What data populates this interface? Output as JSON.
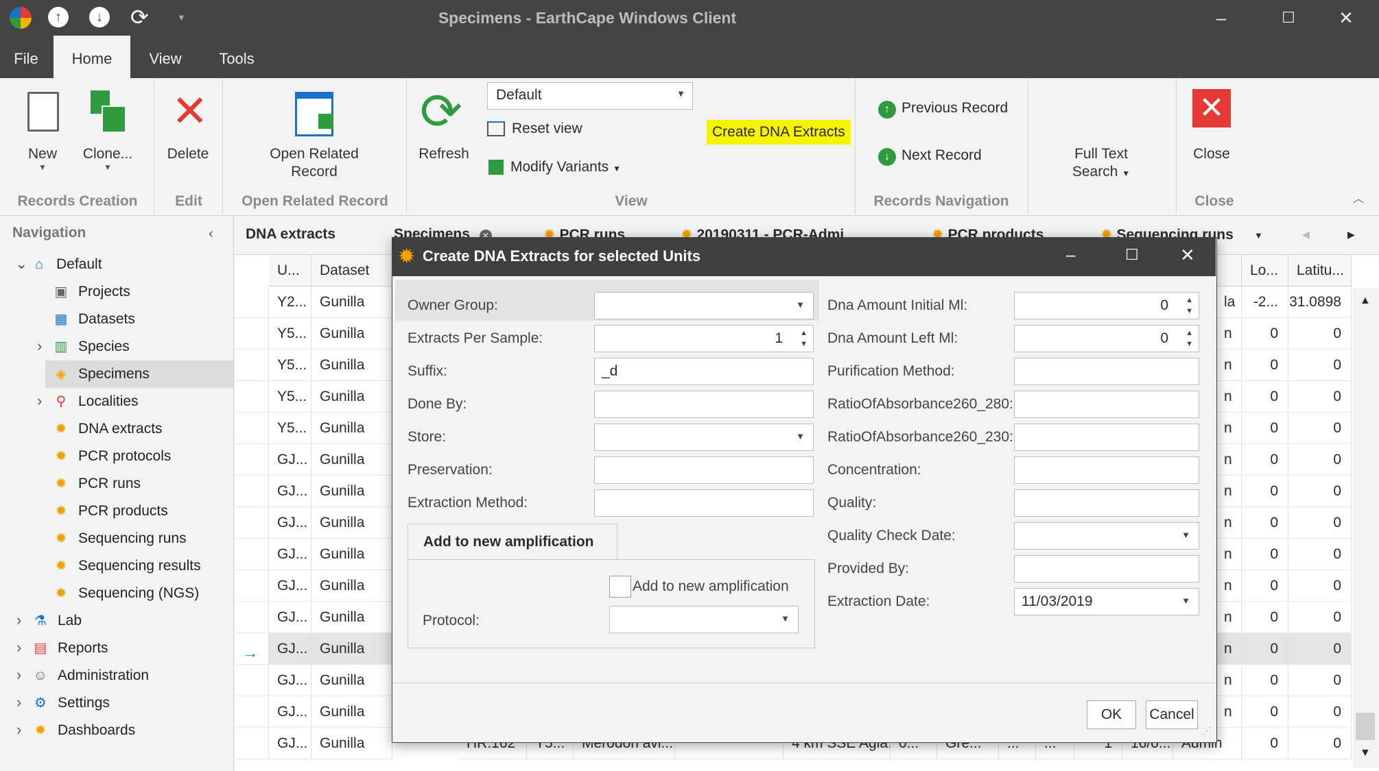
{
  "window": {
    "title": "Specimens - EarthCape Windows Client"
  },
  "menu": {
    "file": "File",
    "home": "Home",
    "view": "View",
    "tools": "Tools"
  },
  "ribbon": {
    "new": "New",
    "clone": "Clone...",
    "delete": "Delete",
    "open_related": "Open Related Record",
    "refresh": "Refresh",
    "view_combo": "Default",
    "reset_view": "Reset view",
    "modify_variants": "Modify Variants",
    "create_dna": "Create DNA Extracts",
    "prev_record": "Previous Record",
    "next_record": "Next Record",
    "full_text": "Full Text Search",
    "close": "Close",
    "groups": {
      "records_creation": "Records Creation",
      "edit": "Edit",
      "open_related": "Open Related Record",
      "view": "View",
      "records_nav": "Records Navigation",
      "close": "Close"
    },
    "colors": {
      "highlight": "#f4f400",
      "delete": "#e53935",
      "close_bg": "#e53935",
      "green": "#2e9b3e",
      "blue": "#1a73c8"
    }
  },
  "navigation": {
    "header": "Navigation",
    "items": [
      "Default",
      "Projects",
      "Datasets",
      "Species",
      "Specimens",
      "Localities",
      "DNA extracts",
      "PCR protocols",
      "PCR runs",
      "PCR products",
      "Sequencing runs",
      "Sequencing results",
      "Sequencing (NGS)",
      "Lab",
      "Reports",
      "Administration",
      "Settings",
      "Dashboards"
    ]
  },
  "grid": {
    "caption": "DNA extracts",
    "tabs": [
      "Specimens",
      "PCR runs",
      "20190311 - PCR-Admi",
      "PCR products",
      "Sequencing runs"
    ],
    "headers": [
      "U...",
      "Dataset",
      "Lo...",
      "Latitu..."
    ],
    "rows": [
      {
        "u": "Y2...",
        "ds": "Gunilla",
        "x": "la",
        "lo": "-2...",
        "lat": "31.0898"
      },
      {
        "u": "Y5...",
        "ds": "Gunilla",
        "x": "n",
        "lo": "0",
        "lat": "0"
      },
      {
        "u": "Y5...",
        "ds": "Gunilla",
        "x": "n",
        "lo": "0",
        "lat": "0"
      },
      {
        "u": "Y5...",
        "ds": "Gunilla",
        "x": "n",
        "lo": "0",
        "lat": "0"
      },
      {
        "u": "Y5...",
        "ds": "Gunilla",
        "x": "n",
        "lo": "0",
        "lat": "0"
      },
      {
        "u": "GJ...",
        "ds": "Gunilla",
        "x": "n",
        "lo": "0",
        "lat": "0"
      },
      {
        "u": "GJ...",
        "ds": "Gunilla",
        "x": "n",
        "lo": "0",
        "lat": "0"
      },
      {
        "u": "GJ...",
        "ds": "Gunilla",
        "x": "n",
        "lo": "0",
        "lat": "0"
      },
      {
        "u": "GJ...",
        "ds": "Gunilla",
        "x": "n",
        "lo": "0",
        "lat": "0"
      },
      {
        "u": "GJ...",
        "ds": "Gunilla",
        "x": "n",
        "lo": "0",
        "lat": "0"
      },
      {
        "u": "GJ...",
        "ds": "Gunilla",
        "x": "n",
        "lo": "0",
        "lat": "0"
      },
      {
        "u": "GJ...",
        "ds": "Gunilla",
        "x": "n",
        "lo": "0",
        "lat": "0"
      },
      {
        "u": "GJ...",
        "ds": "Gunilla",
        "x": "n",
        "lo": "0",
        "lat": "0"
      },
      {
        "u": "GJ...",
        "ds": "Gunilla",
        "x": "n",
        "lo": "0",
        "lat": "0"
      }
    ],
    "last_row": {
      "u": "GJ...",
      "ds": "Gunilla",
      "c1": "HR.162",
      "c2": "Y5...",
      "c3": "Merodon avi...",
      "c4": "4 km SSE Agia...",
      "c5": "0...",
      "c6": "Gre...",
      "c7": "...",
      "c8": "...",
      "c9": "1",
      "c10": "16/0...",
      "c11": "Admin",
      "lo": "0",
      "lat": "0"
    }
  },
  "dialog": {
    "title": "Create DNA Extracts for selected Units",
    "left": {
      "owner_group": "Owner Group:",
      "extracts_per_sample": "Extracts Per Sample:",
      "extracts_per_sample_value": "1",
      "suffix": "Suffix:",
      "suffix_value": "_d",
      "done_by": "Done By:",
      "store": "Store:",
      "preservation": "Preservation:",
      "extraction_method": "Extraction Method:"
    },
    "amplification": {
      "tab": "Add to new amplification",
      "checkbox": "Add to new amplification",
      "protocol": "Protocol:"
    },
    "right": {
      "dna_initial": "Dna Amount Initial Ml:",
      "dna_initial_value": "0",
      "dna_left": "Dna Amount Left Ml:",
      "dna_left_value": "0",
      "purification": "Purification Method:",
      "ratio280": "RatioOfAbsorbance260_280:",
      "ratio230": "RatioOfAbsorbance260_230:",
      "concentration": "Concentration:",
      "quality": "Quality:",
      "quality_date": "Quality Check Date:",
      "provided_by": "Provided By:",
      "extraction_date": "Extraction Date:",
      "extraction_date_value": "11/03/2019"
    },
    "ok": "OK",
    "cancel": "Cancel"
  }
}
